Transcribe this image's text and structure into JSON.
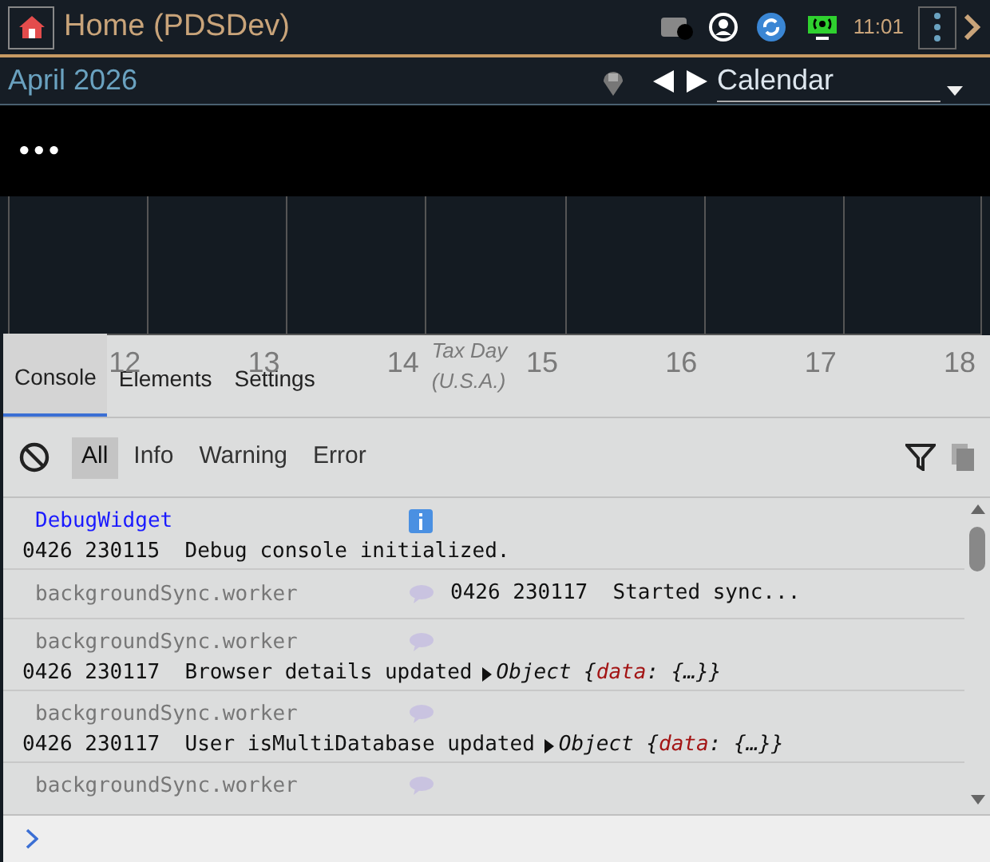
{
  "header": {
    "title": "Home (PDSDev)",
    "time": "11:01"
  },
  "subheader": {
    "month": "April 2026",
    "view": "Calendar"
  },
  "banner": {
    "text": "•••"
  },
  "calendar": {
    "days": [
      {
        "label": "12"
      },
      {
        "label": "13"
      },
      {
        "label": "14"
      },
      {
        "label": "15",
        "event": "Tax Day (U.S.A.)"
      },
      {
        "label": "16"
      },
      {
        "label": "17"
      },
      {
        "label": "18"
      }
    ]
  },
  "console": {
    "tabs": [
      {
        "label": "Console",
        "selected": true
      },
      {
        "label": "Elements",
        "selected": false
      },
      {
        "label": "Settings",
        "selected": false
      }
    ],
    "filters": [
      {
        "label": "All",
        "selected": true
      },
      {
        "label": "Info",
        "selected": false
      },
      {
        "label": "Warning",
        "selected": false
      },
      {
        "label": "Error",
        "selected": false
      }
    ],
    "entries": [
      {
        "kind": "info",
        "source": "DebugWidget",
        "timestamp": "0426 230115",
        "message": "Debug console initialized."
      },
      {
        "kind": "inline",
        "source": "backgroundSync.worker",
        "timestamp": "0426 230117",
        "message": "Started sync..."
      },
      {
        "kind": "object",
        "source": "backgroundSync.worker",
        "timestamp": "0426 230117",
        "message": "Browser details updated",
        "object_open": "Object {",
        "key": "data",
        "object_close": ": {…}}"
      },
      {
        "kind": "object",
        "source": "backgroundSync.worker",
        "timestamp": "0426 230117",
        "message": "User isMultiDatabase updated",
        "object_open": "Object {",
        "key": "data",
        "object_close": ": {…}}"
      },
      {
        "kind": "source_only",
        "source": "backgroundSync.worker"
      }
    ]
  }
}
